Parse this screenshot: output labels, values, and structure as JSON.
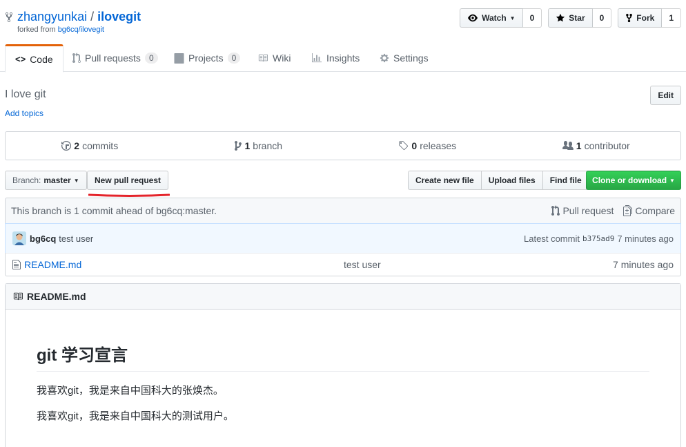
{
  "repo": {
    "owner": "zhangyunkai",
    "separator": "/",
    "name": "ilovegit",
    "forked_prefix": "forked from ",
    "forked_from": "bg6cq/ilovegit"
  },
  "actions": {
    "watch": {
      "label": "Watch",
      "count": "0"
    },
    "star": {
      "label": "Star",
      "count": "0"
    },
    "fork": {
      "label": "Fork",
      "count": "1"
    }
  },
  "tabs": [
    {
      "label": "Code",
      "counter": null,
      "icon": "code-icon"
    },
    {
      "label": "Pull requests",
      "counter": "0",
      "icon": "pull-request-icon"
    },
    {
      "label": "Projects",
      "counter": "0",
      "icon": "project-icon"
    },
    {
      "label": "Wiki",
      "counter": null,
      "icon": "book-icon"
    },
    {
      "label": "Insights",
      "counter": null,
      "icon": "graph-icon"
    },
    {
      "label": "Settings",
      "counter": null,
      "icon": "gear-icon"
    }
  ],
  "description": "I love git",
  "add_topics": "Add topics",
  "edit_label": "Edit",
  "summary": {
    "commits": {
      "num": "2",
      "label": "commits"
    },
    "branch": {
      "num": "1",
      "label": "branch"
    },
    "releases": {
      "num": "0",
      "label": "releases"
    },
    "contributor": {
      "num": "1",
      "label": "contributor"
    }
  },
  "file_nav": {
    "branch_prefix": "Branch:",
    "branch_name": "master",
    "new_pull_request": "New pull request",
    "create_new_file": "Create new file",
    "upload_files": "Upload files",
    "find_file": "Find file",
    "clone_or_download": "Clone or download"
  },
  "infobar": {
    "message": "This branch is 1 commit ahead of bg6cq:master.",
    "pull_request": "Pull request",
    "compare": "Compare"
  },
  "latest_commit": {
    "author": "bg6cq",
    "message": "test user",
    "prefix": "Latest commit",
    "sha": "b375ad9",
    "age": "7 minutes ago"
  },
  "files": [
    {
      "name": "README.md",
      "message": "test user",
      "age": "7 minutes ago"
    }
  ],
  "readme": {
    "title": "README.md",
    "h1": "git 学习宣言",
    "p1": "我喜欢git，我是来自中国科大的张焕杰。",
    "p2": "我喜欢git，我是来自中国科大的测试用户。"
  },
  "colors": {
    "link": "#0366d6",
    "tab_accent": "#e36209",
    "clone_green": "#28a745",
    "annotation_red": "#e4242b"
  }
}
